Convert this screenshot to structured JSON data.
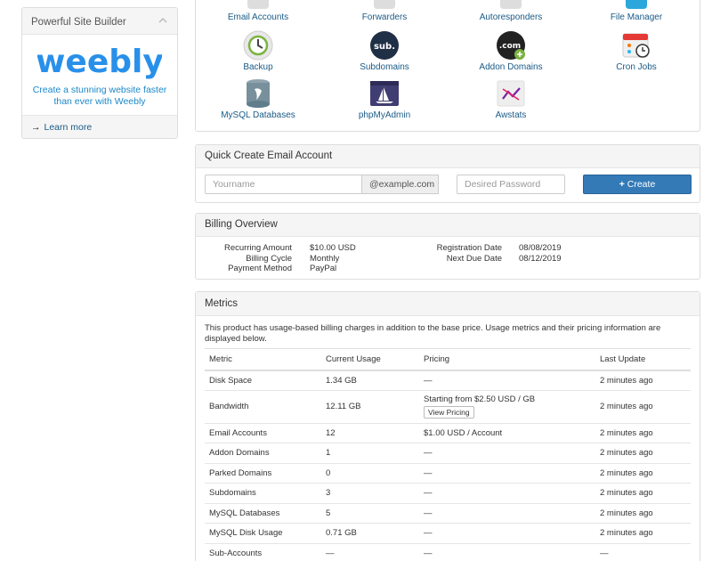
{
  "sidebar": {
    "title": "Powerful Site Builder",
    "logo_text": "weebly",
    "description": "Create a stunning website faster than ever with Weebly",
    "learn_more": "Learn more"
  },
  "shortcuts": [
    {
      "label": "Email Accounts",
      "icon": "email-icon"
    },
    {
      "label": "Forwarders",
      "icon": "forwarders-icon"
    },
    {
      "label": "Autoresponders",
      "icon": "autoresponders-icon"
    },
    {
      "label": "File Manager",
      "icon": "file-manager-icon"
    },
    {
      "label": "Backup",
      "icon": "backup-icon"
    },
    {
      "label": "Subdomains",
      "icon": "subdomains-icon",
      "badge": "sub."
    },
    {
      "label": "Addon Domains",
      "icon": "addon-domains-icon",
      "badge": ".com"
    },
    {
      "label": "Cron Jobs",
      "icon": "cron-jobs-icon"
    },
    {
      "label": "MySQL Databases",
      "icon": "mysql-icon"
    },
    {
      "label": "phpMyAdmin",
      "icon": "phpmyadmin-icon"
    },
    {
      "label": "Awstats",
      "icon": "awstats-icon"
    }
  ],
  "quick_create": {
    "title": "Quick Create Email Account",
    "username_placeholder": "Yourname",
    "domain_suffix": "@example.com",
    "password_placeholder": "Desired Password",
    "create_label": "Create"
  },
  "billing": {
    "title": "Billing Overview",
    "left": [
      {
        "label": "Recurring Amount",
        "value": "$10.00 USD"
      },
      {
        "label": "Billing Cycle",
        "value": "Monthly"
      },
      {
        "label": "Payment Method",
        "value": "PayPal"
      }
    ],
    "right": [
      {
        "label": "Registration Date",
        "value": "08/08/2019"
      },
      {
        "label": "Next Due Date",
        "value": "08/12/2019"
      }
    ]
  },
  "metrics": {
    "title": "Metrics",
    "description": "This product has usage-based billing charges in addition to the base price. Usage metrics and their pricing information are displayed below.",
    "columns": [
      "Metric",
      "Current Usage",
      "Pricing",
      "Last Update"
    ],
    "view_pricing_label": "View Pricing",
    "rows": [
      {
        "metric": "Disk Space",
        "usage": "1.34 GB",
        "pricing": "—",
        "updated": "2 minutes ago"
      },
      {
        "metric": "Bandwidth",
        "usage": "12.11 GB",
        "pricing": "Starting from $2.50 USD / GB",
        "updated": "2 minutes ago"
      },
      {
        "metric": "Email Accounts",
        "usage": "12",
        "pricing": "$1.00 USD / Account",
        "updated": "2 minutes ago"
      },
      {
        "metric": "Addon Domains",
        "usage": "1",
        "pricing": "—",
        "updated": "2 minutes ago"
      },
      {
        "metric": "Parked Domains",
        "usage": "0",
        "pricing": "—",
        "updated": "2 minutes ago"
      },
      {
        "metric": "Subdomains",
        "usage": "3",
        "pricing": "—",
        "updated": "2 minutes ago"
      },
      {
        "metric": "MySQL Databases",
        "usage": "5",
        "pricing": "—",
        "updated": "2 minutes ago"
      },
      {
        "metric": "MySQL Disk Usage",
        "usage": "0.71 GB",
        "pricing": "—",
        "updated": "2 minutes ago"
      },
      {
        "metric": "Sub-Accounts",
        "usage": "—",
        "pricing": "—",
        "updated": "—"
      }
    ]
  }
}
